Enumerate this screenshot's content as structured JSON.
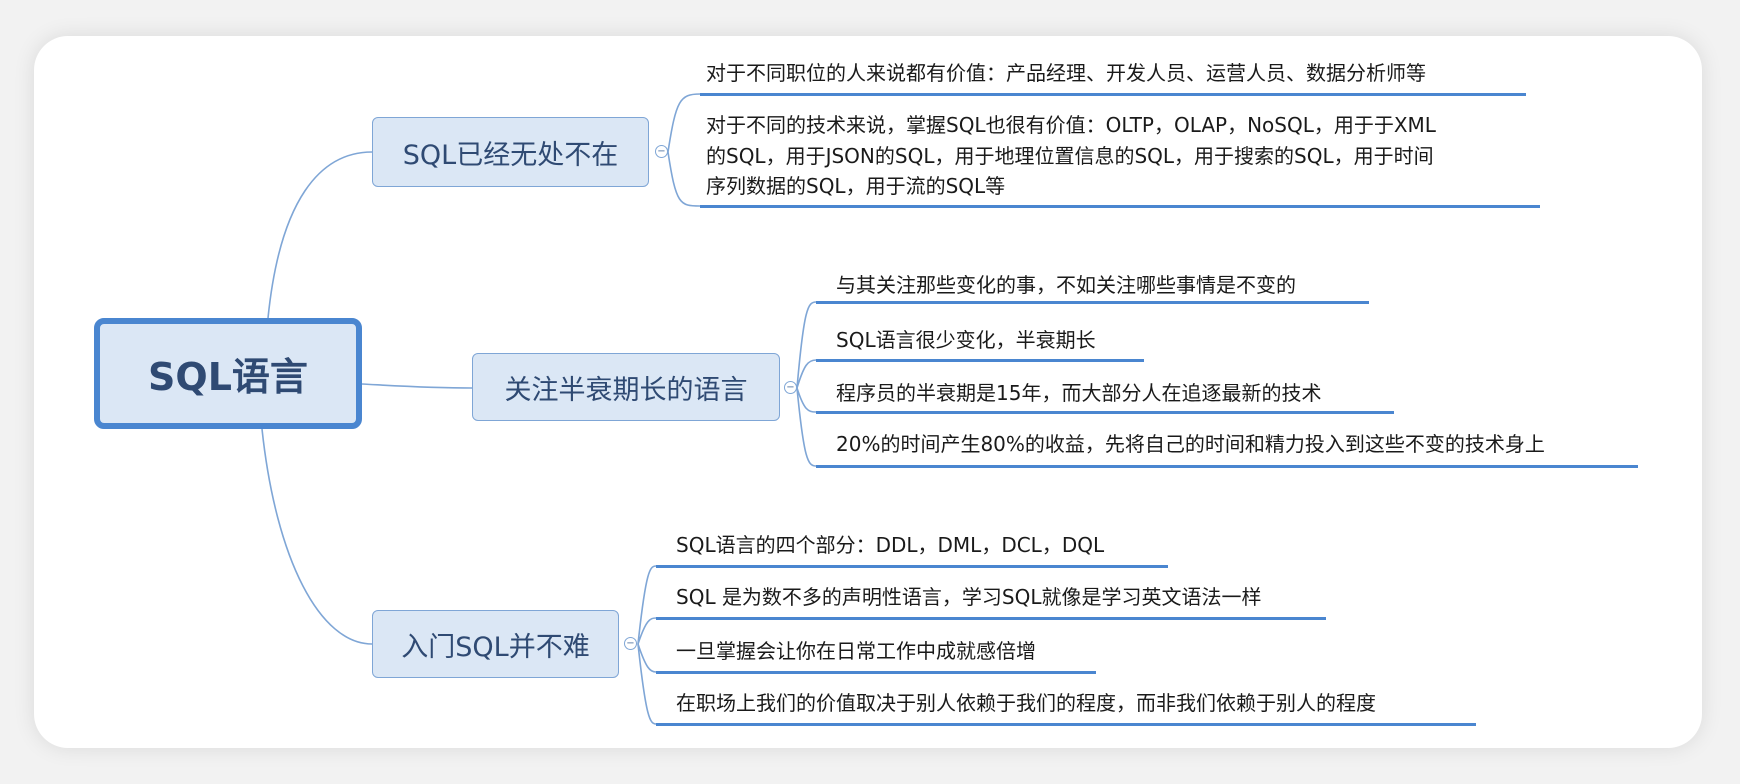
{
  "root": {
    "label": "SQL语言"
  },
  "branches": [
    {
      "label": "SQL已经无处不在",
      "items": [
        "对于不同职位的人来说都有价值：产品经理、开发人员、运营人员、数据分析师等",
        "对于不同的技术来说，掌握SQL也很有价值：OLTP，OLAP，NoSQL，用于于XML",
        "的SQL，用于JSON的SQL，用于地理位置信息的SQL，用于搜索的SQL，用于时间",
        "序列数据的SQL，用于流的SQL等"
      ]
    },
    {
      "label": "关注半衰期长的语言",
      "items": [
        "与其关注那些变化的事，不如关注哪些事情是不变的",
        "SQL语言很少变化，半衰期长",
        "程序员的半衰期是15年，而大部分人在追逐最新的技术",
        "20%的时间产生80%的收益，先将自己的时间和精力投入到这些不变的技术身上"
      ]
    },
    {
      "label": "入门SQL并不难",
      "items": [
        "SQL语言的四个部分：DDL，DML，DCL，DQL",
        "SQL 是为数不多的声明性语言，学习SQL就像是学习英文语法一样",
        "一旦掌握会让你在日常工作中成就感倍增",
        "在职场上我们的价值取决于别人依赖于我们的程度，而非我们依赖于别人的程度"
      ]
    }
  ],
  "colors": {
    "line": "#7fa6d6",
    "underline": "#4a86d0",
    "node_fill": "#dbe7f5",
    "node_text": "#2f4a73"
  },
  "icons": {
    "collapse": "collapse-circle-icon"
  }
}
